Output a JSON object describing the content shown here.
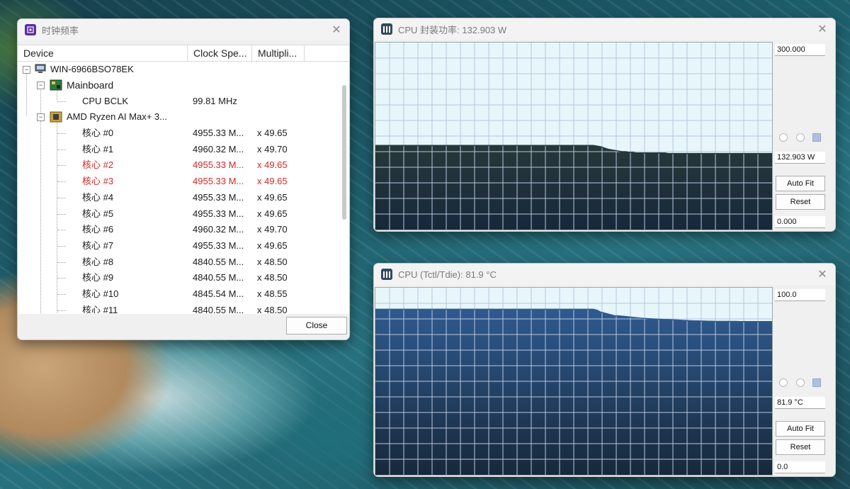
{
  "clock_window": {
    "title": "时钟频率",
    "columns": [
      "Device",
      "Clock Spe...",
      "Multipli..."
    ],
    "root": "WIN-6966BSO78EK",
    "mainboard": "Mainboard",
    "bclk": {
      "name": "CPU BCLK",
      "clock": "99.81 MHz"
    },
    "cpu": "AMD Ryzen AI Max+ 3...",
    "cores": [
      {
        "name": "核心 #0",
        "clock": "4955.33 M...",
        "mult": "x 49.65",
        "hl": false
      },
      {
        "name": "核心 #1",
        "clock": "4960.32 M...",
        "mult": "x 49.70",
        "hl": false
      },
      {
        "name": "核心 #2",
        "clock": "4955.33 M...",
        "mult": "x 49.65",
        "hl": true
      },
      {
        "name": "核心 #3",
        "clock": "4955.33 M...",
        "mult": "x 49.65",
        "hl": true
      },
      {
        "name": "核心 #4",
        "clock": "4955.33 M...",
        "mult": "x 49.65",
        "hl": false
      },
      {
        "name": "核心 #5",
        "clock": "4955.33 M...",
        "mult": "x 49.65",
        "hl": false
      },
      {
        "name": "核心 #6",
        "clock": "4960.32 M...",
        "mult": "x 49.70",
        "hl": false
      },
      {
        "name": "核心 #7",
        "clock": "4955.33 M...",
        "mult": "x 49.65",
        "hl": false
      },
      {
        "name": "核心 #8",
        "clock": "4840.55 M...",
        "mult": "x 48.50",
        "hl": false
      },
      {
        "name": "核心 #9",
        "clock": "4840.55 M...",
        "mult": "x 48.50",
        "hl": false
      },
      {
        "name": "核心 #10",
        "clock": "4845.54 M...",
        "mult": "x 48.55",
        "hl": false
      },
      {
        "name": "核心 #11",
        "clock": "4840.55 M...",
        "mult": "x 48.50",
        "hl": false
      }
    ],
    "close_label": "Close",
    "highlight_color": "#d62828",
    "icon_color": "#5b2ca0"
  },
  "power_graph": {
    "title": "CPU 封装功率: 132.903 W",
    "max_label": "300.000",
    "current_label": "132.903 W",
    "min_label": "0.000",
    "autofit_label": "Auto Fit",
    "reset_label": "Reset",
    "fill_color": "#27383a",
    "chart_data": {
      "type": "area",
      "ylim": [
        0,
        300
      ],
      "values": [
        135,
        135,
        135,
        135,
        135,
        135,
        135,
        135,
        135,
        135,
        135,
        135,
        135,
        135,
        135,
        135,
        135,
        135,
        135,
        135,
        135,
        135,
        135,
        135,
        135,
        135,
        135,
        135,
        135,
        135,
        135,
        135,
        135,
        135,
        135,
        135,
        135,
        135,
        135,
        135,
        135,
        135,
        135,
        135,
        135,
        135,
        135,
        135,
        135,
        135,
        135,
        135,
        135,
        135,
        135,
        135,
        135,
        135,
        135,
        135,
        135,
        135,
        134,
        133,
        131,
        129,
        128,
        127,
        126,
        125,
        125,
        124,
        124,
        123,
        123,
        123,
        123,
        123,
        123,
        123,
        123,
        123,
        122,
        122,
        122,
        122,
        122,
        122,
        122,
        122,
        122,
        122,
        122,
        122,
        122,
        122,
        122,
        122,
        122,
        122,
        122,
        122,
        122,
        122,
        122,
        122,
        122,
        122,
        122,
        122,
        122,
        122
      ]
    }
  },
  "temp_graph": {
    "title": "CPU (Tctl/Tdie): 81.9 °C",
    "max_label": "100.0",
    "current_label": "81.9 °C",
    "min_label": "0.0",
    "autofit_label": "Auto Fit",
    "reset_label": "Reset",
    "fill_color": "#2f5a8f",
    "chart_data": {
      "type": "area",
      "ylim": [
        0,
        100
      ],
      "values": [
        88.5,
        88.5,
        88.5,
        88.5,
        88.5,
        88.5,
        88.5,
        88.5,
        88.5,
        88.5,
        88.5,
        88.5,
        88.5,
        88.5,
        88.5,
        88.5,
        88.5,
        88.5,
        88.5,
        88.5,
        88.5,
        88.5,
        88.5,
        88.5,
        88.5,
        88.5,
        88.5,
        88.5,
        88.5,
        88.5,
        88.5,
        88.5,
        88.5,
        88.5,
        88.5,
        88.5,
        88.5,
        88.5,
        88.5,
        88.5,
        88.5,
        88.5,
        88.5,
        88.5,
        88.5,
        88.5,
        88.5,
        88.5,
        88.5,
        88.5,
        88.5,
        88.5,
        88.5,
        88.5,
        88.5,
        88.5,
        88.5,
        88.5,
        88.5,
        88.5,
        88.5,
        88.5,
        88,
        87,
        86.5,
        86,
        85.5,
        85,
        85,
        84.8,
        84.6,
        84.4,
        84.2,
        84,
        83.8,
        83.6,
        83.5,
        83.4,
        83.3,
        83.2,
        83.1,
        83,
        83,
        82.9,
        82.8,
        82.7,
        82.6,
        82.5,
        82.4,
        82.3,
        82.3,
        82.2,
        82.2,
        82.1,
        82.1,
        82,
        82,
        82,
        82,
        82,
        82,
        82,
        81.9,
        81.9,
        81.9,
        81.9,
        81.9,
        81.9,
        81.9,
        81.9,
        81.9,
        81.9
      ]
    }
  }
}
